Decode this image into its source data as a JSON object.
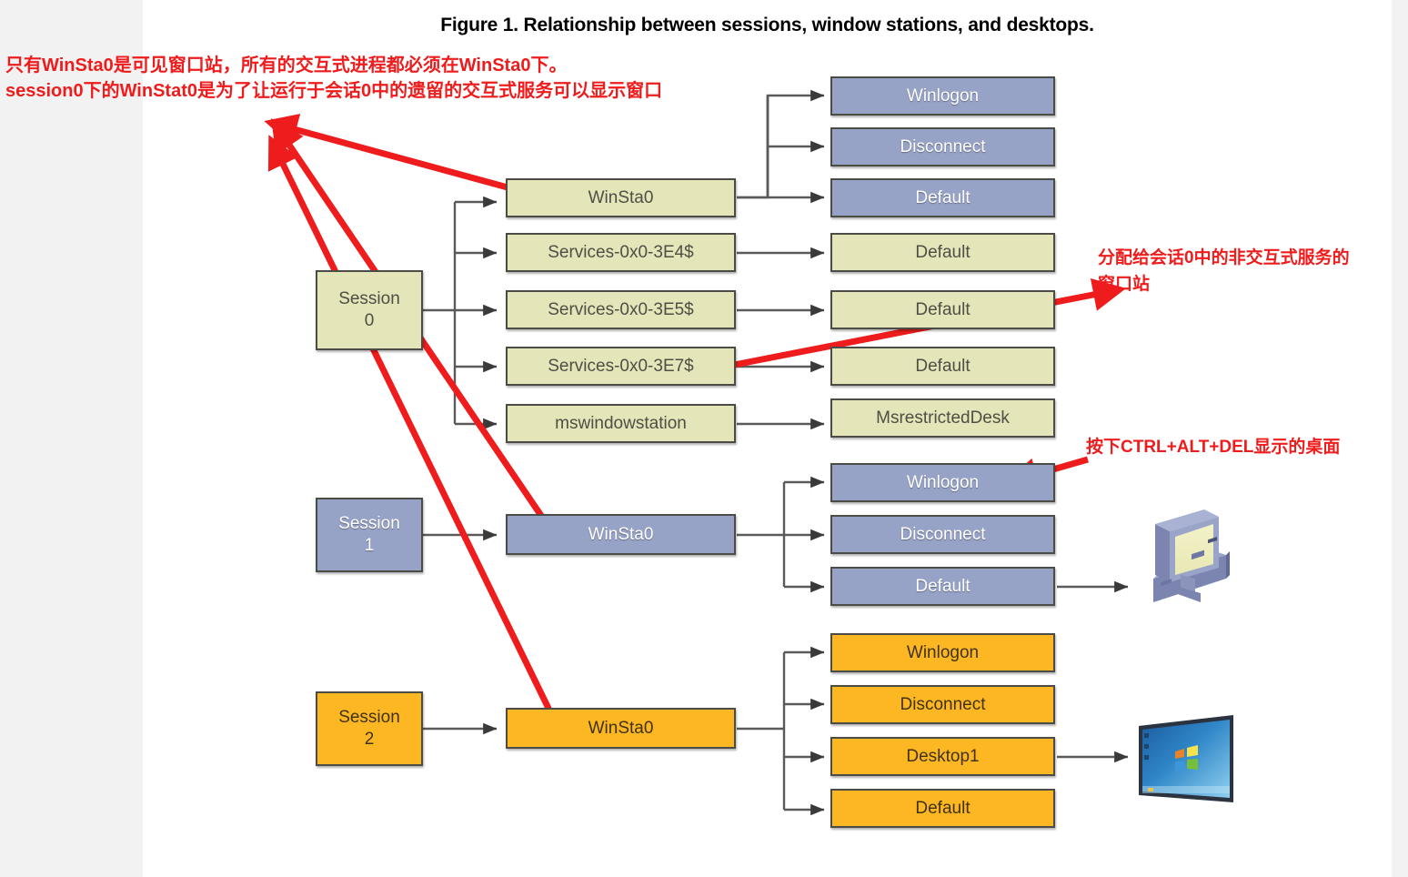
{
  "figure": {
    "title": "Figure 1. Relationship between sessions, window stations, and desktops."
  },
  "annotations": {
    "top_note": "只有WinSta0是可见窗口站，所有的交互式进程都必须在WinSta0下。\nsession0下的WinStat0是为了让运行于会话0中的遗留的交互式服务可以显示窗口",
    "noninteractive_note": "分配给会话0中的非交互式服务的窗口站",
    "ctrl_alt_del_note": "按下CTRL+ALT+DEL显示的桌面"
  },
  "colors": {
    "olive": "#e4e6b9",
    "blue": "#97a3c6",
    "amber": "#fcb722",
    "border": "#4c4c46",
    "annotation_red": "#ee1c1c",
    "wire": "#5a5a5a"
  },
  "sessions": [
    {
      "id": "session-0",
      "label_line1": "Session",
      "label_line2": "0",
      "color": "olive",
      "window_stations": [
        {
          "name": "WinSta0",
          "color": "olive",
          "desktops": [
            {
              "name": "Winlogon",
              "color": "blue"
            },
            {
              "name": "Disconnect",
              "color": "blue"
            },
            {
              "name": "Default",
              "color": "blue"
            }
          ]
        },
        {
          "name": "Services-0x0-3E4$",
          "color": "olive",
          "desktops": [
            {
              "name": "Default",
              "color": "olive"
            }
          ]
        },
        {
          "name": "Services-0x0-3E5$",
          "color": "olive",
          "desktops": [
            {
              "name": "Default",
              "color": "olive"
            }
          ]
        },
        {
          "name": "Services-0x0-3E7$",
          "color": "olive",
          "desktops": [
            {
              "name": "Default",
              "color": "olive"
            }
          ]
        },
        {
          "name": "mswindowstation",
          "color": "olive",
          "desktops": [
            {
              "name": "MsrestrictedDesk",
              "color": "olive"
            }
          ]
        }
      ]
    },
    {
      "id": "session-1",
      "label_line1": "Session",
      "label_line2": "1",
      "color": "blue",
      "window_stations": [
        {
          "name": "WinSta0",
          "color": "blue",
          "desktops": [
            {
              "name": "Winlogon",
              "color": "blue"
            },
            {
              "name": "Disconnect",
              "color": "blue"
            },
            {
              "name": "Default",
              "color": "blue"
            }
          ]
        }
      ],
      "display_icon": "desktop-computer-icon"
    },
    {
      "id": "session-2",
      "label_line1": "Session",
      "label_line2": "2",
      "color": "amber",
      "window_stations": [
        {
          "name": "WinSta0",
          "color": "amber",
          "desktops": [
            {
              "name": "Winlogon",
              "color": "amber"
            },
            {
              "name": "Disconnect",
              "color": "amber"
            },
            {
              "name": "Desktop1",
              "color": "amber"
            },
            {
              "name": "Default",
              "color": "amber"
            }
          ]
        }
      ],
      "display_icon": "windows7-desktop-icon"
    }
  ]
}
